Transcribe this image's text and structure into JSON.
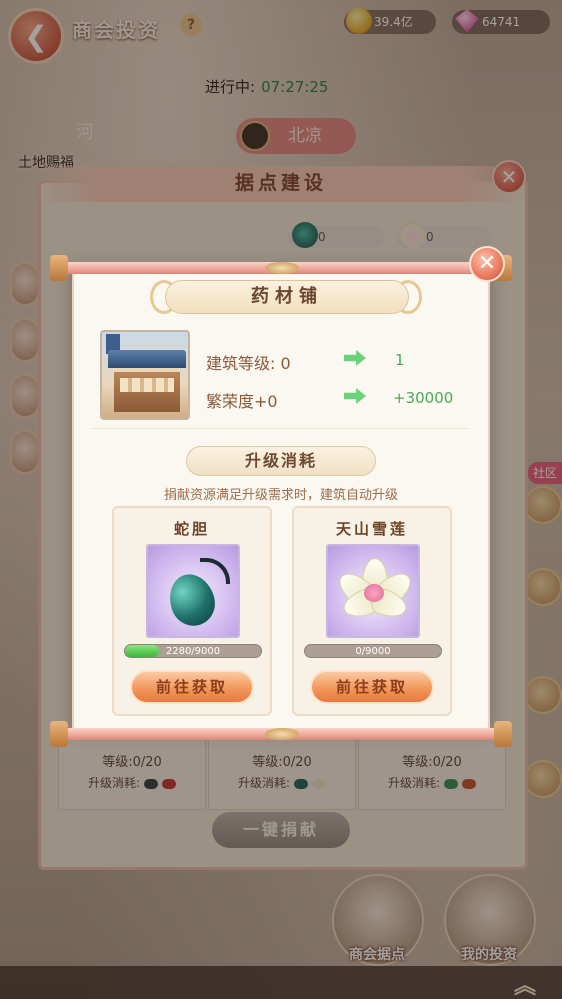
{
  "header": {
    "title": "商会投资",
    "help_icon": "?",
    "gold": "39.4亿",
    "gems": "64741"
  },
  "status": {
    "label": "进行中:",
    "time": "07:27:25"
  },
  "map": {
    "river_label": "河",
    "land_blessing": "土地赐福",
    "city_name": "北凉"
  },
  "base_panel": {
    "title": "据点建设",
    "res_counts": [
      "0",
      "0"
    ],
    "cells": [
      {
        "level": "等级:0/20",
        "cost_label": "升级消耗:"
      },
      {
        "level": "等级:0/20",
        "cost_label": "升级消耗:"
      },
      {
        "level": "等级:0/20",
        "cost_label": "升级消耗:"
      }
    ],
    "donate_all": "一键捐献"
  },
  "side": {
    "community": "社区"
  },
  "modal": {
    "title": "药材铺",
    "close": "✕",
    "build_level_label": "建筑等级: 0",
    "build_level_next": "1",
    "prosperity_label": "繁荣度+0",
    "prosperity_next": "+30000",
    "cost_title": "升级消耗",
    "hint": "捐献资源满足升级需求时，建筑自动升级",
    "resources": [
      {
        "name": "蛇胆",
        "progress_text": "2280/9000",
        "progress": 0.2533,
        "button": "前往获取"
      },
      {
        "name": "天山雪莲",
        "progress_text": "0/9000",
        "progress": 0,
        "button": "前往获取"
      }
    ]
  },
  "bottom": {
    "base_label": "商会据点",
    "invest_label": "我的投资",
    "up_icon": "︽"
  },
  "colors": {
    "accent": "#ea7a5e",
    "progress_green": "#3fb73c",
    "next_value_green": "#4caa5a",
    "title_brown": "#6a4730"
  }
}
